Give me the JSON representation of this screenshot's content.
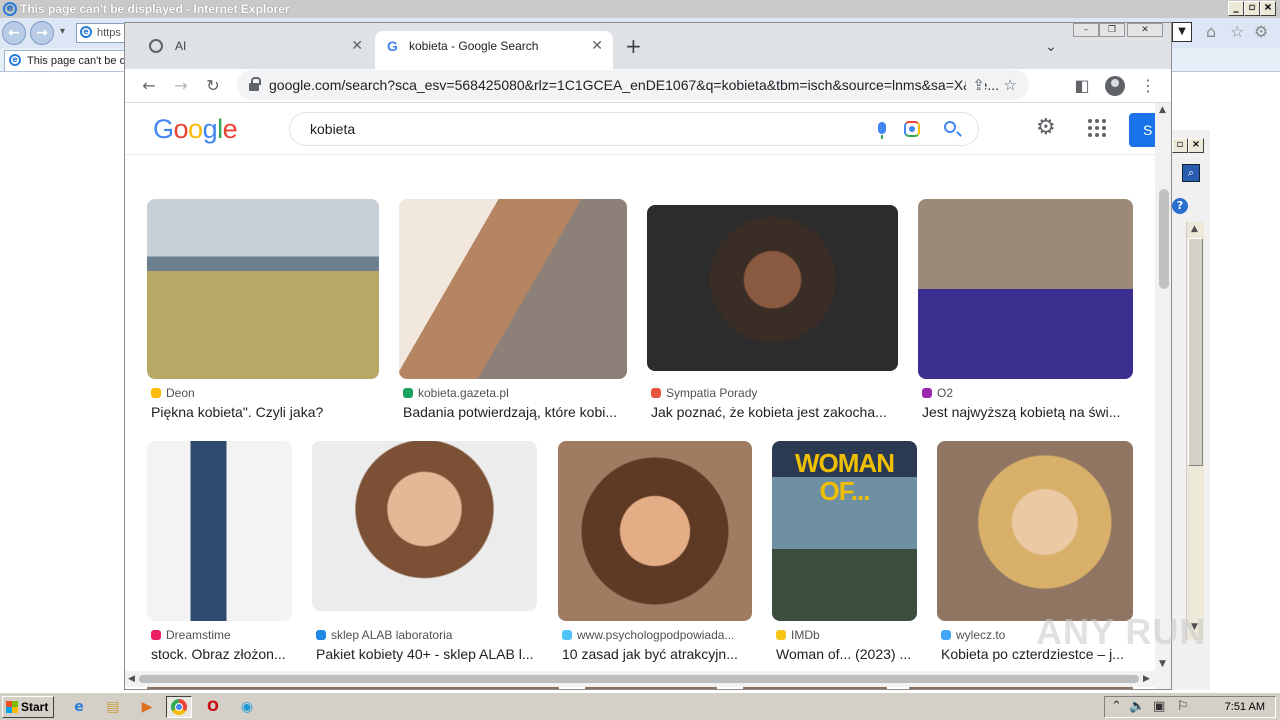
{
  "ie": {
    "title": "This page can't be displayed - Internet Explorer",
    "address": "https",
    "tab_label": "This page can't be d"
  },
  "chrome": {
    "tabs": [
      {
        "label": "AI",
        "icon": "globe-icon"
      },
      {
        "label": "kobieta - Google Search",
        "icon": "google-favicon"
      }
    ],
    "url": "google.com/search?sca_esv=568425080&rlz=1C1GCEA_enDE1067&q=kobieta&tbm=isch&source=lnms&sa=X&ve..."
  },
  "google": {
    "logo": "Google",
    "query": "kobieta",
    "signin_label": "S",
    "colors": {
      "blue": "#4285f4",
      "red": "#ea4335",
      "yellow": "#fbbc05",
      "green": "#34a853",
      "signin": "#1a73e8"
    }
  },
  "results": [
    {
      "source": "Deon",
      "title": "Piękna kobieta\". Czyli jaka?",
      "source_color": "#fbbc05"
    },
    {
      "source": "kobieta.gazeta.pl",
      "title": "Badania potwierdzają, które kobi...",
      "source_color": "#1aa260"
    },
    {
      "source": "Sympatia Porady",
      "title": "Jak poznać, że kobieta jest zakocha...",
      "source_color": "#e8553d"
    },
    {
      "source": "O2",
      "title": "Jest najwyższą kobietą na świ...",
      "source_color": "#9c27b0"
    },
    {
      "source": "Dreamstime",
      "title": "stock. Obraz złożon...",
      "source_color": "#e91e63"
    },
    {
      "source": "sklep ALAB laboratoria",
      "title": "Pakiet kobiety 40+ - sklep ALAB l...",
      "source_color": "#1e88e5"
    },
    {
      "source": "www.psychologpodpowiada...",
      "title": "10 zasad jak być atrakcyjn...",
      "source_color": "#4fc3f7"
    },
    {
      "source": "IMDb",
      "title": "Woman of... (2023) ...",
      "source_color": "#f5c518"
    },
    {
      "source": "wylecz.to",
      "title": "Kobieta po czterdziestce – j...",
      "source_color": "#42a5f5"
    }
  ],
  "poster": {
    "text": "WOMAN OF..."
  },
  "taskbar": {
    "start_label": "Start",
    "clock": "7:51 AM"
  },
  "watermark": "ANY RUN"
}
